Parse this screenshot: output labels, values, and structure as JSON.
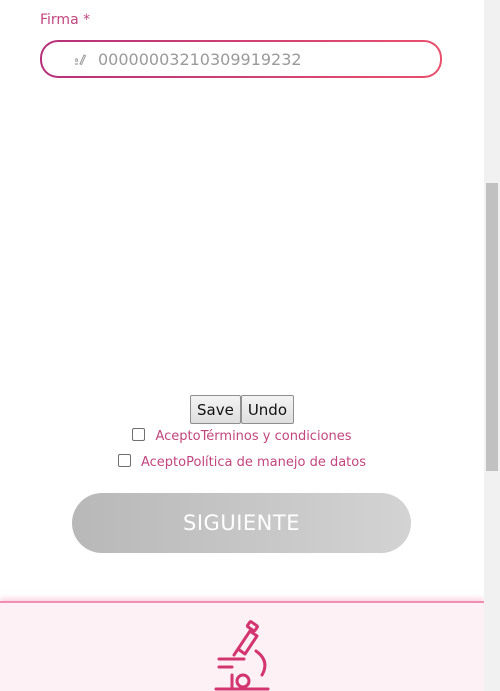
{
  "form": {
    "firma_label": "Firma *",
    "firma_value": "0000000321030991923​2",
    "firma_icon": "signature-pen-icon"
  },
  "signature_pad": {
    "save_label": "Save",
    "undo_label": "Undo"
  },
  "consents": [
    {
      "prefix": "Acepto",
      "link": "Términos y condiciones",
      "checked": false
    },
    {
      "prefix": "Acepto",
      "link": "Política de manejo de datos",
      "checked": false
    }
  ],
  "next_button": {
    "label": "SIGUIENTE"
  },
  "footer": {
    "icon": "microscope-icon"
  },
  "colors": {
    "accent": "#c2457e",
    "field_border_start": "#b5317b",
    "field_border_end": "#e8506d",
    "disabled_button": "#c4c4c4",
    "footer_bg": "#fdf1f5",
    "footer_line": "#f08fb2"
  }
}
